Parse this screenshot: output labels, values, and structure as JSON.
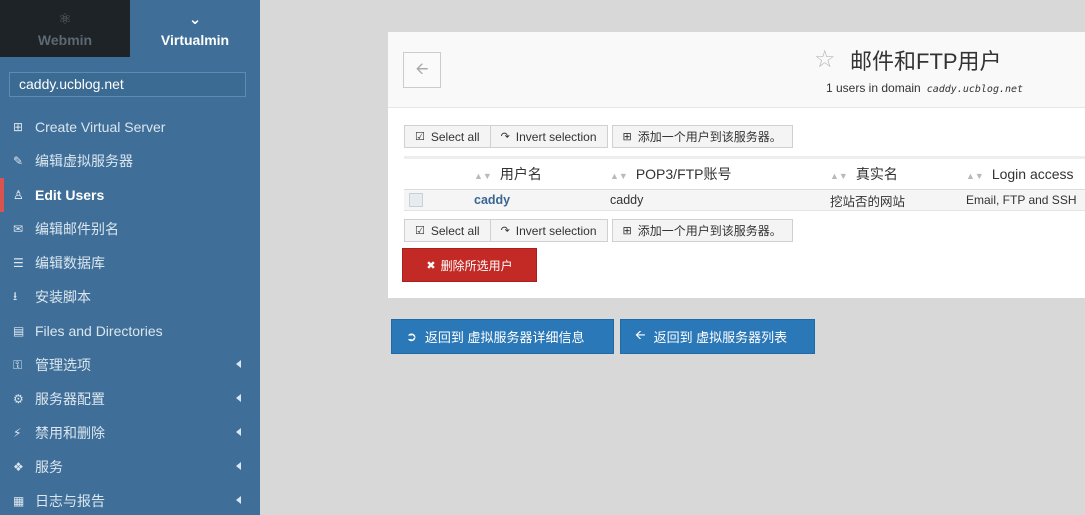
{
  "sidebar": {
    "tabs": [
      {
        "label": "Webmin",
        "icon": "webmin-gear-icon"
      },
      {
        "label": "Virtualmin",
        "icon": "chevron-down-icon"
      }
    ],
    "domain": "caddy.ucblog.net",
    "items": [
      {
        "label": "Create Virtual Server",
        "icon": "plus-square-icon"
      },
      {
        "label": "编辑虚拟服务器",
        "icon": "edit-icon"
      },
      {
        "label": "Edit Users",
        "icon": "users-icon"
      },
      {
        "label": "编辑邮件别名",
        "icon": "envelope-icon"
      },
      {
        "label": "编辑数据库",
        "icon": "database-icon"
      },
      {
        "label": "安装脚本",
        "icon": "download-icon"
      },
      {
        "label": "Files and Directories",
        "icon": "folder-icon"
      },
      {
        "label": "管理选项",
        "icon": "key-icon"
      },
      {
        "label": "服务器配置",
        "icon": "cogs-icon"
      },
      {
        "label": "禁用和删除",
        "icon": "plug-icon"
      },
      {
        "label": "服务",
        "icon": "puzzle-icon"
      },
      {
        "label": "日志与报告",
        "icon": "file-icon"
      }
    ]
  },
  "header": {
    "title": "邮件和FTP用户",
    "subtitle": "1 users in domain",
    "domain": "caddy.ucblog.net"
  },
  "actions": {
    "select_all": "Select all",
    "invert_selection": "Invert selection",
    "add_user": "添加一个用户到该服务器。",
    "delete_selected": "删除所选用户"
  },
  "table": {
    "columns": [
      "用户名",
      "POP3/FTP账号",
      "真实名",
      "Login access"
    ],
    "rows": [
      {
        "username": "caddy",
        "account": "caddy",
        "real_name": "挖站否的网站",
        "access": "Email, FTP and SSH"
      }
    ]
  },
  "footer": {
    "back_server_details": "返回到 虚拟服务器详细信息",
    "back_server_list": "返回到 虚拟服务器列表"
  },
  "colors": {
    "sidebar": "#3f6f98",
    "active_marker": "#d9534f",
    "primary_button": "#2b78b8",
    "danger_button": "#c32a25"
  }
}
